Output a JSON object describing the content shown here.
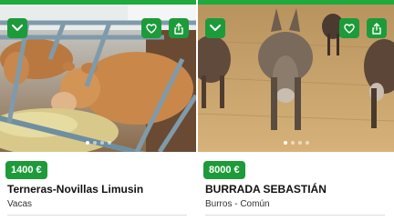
{
  "listings": [
    {
      "price": "1400 €",
      "title": "Terneras-Novillas Limusin",
      "category": "Vacas",
      "photo_icon": "cattle-photo",
      "slides": 4,
      "active_slide": 1
    },
    {
      "price": "8000 €",
      "title": "BURRADA SEBASTIÁN",
      "category": "Burros - Común",
      "photo_icon": "donkey-photo",
      "slides": 4,
      "active_slide": 1
    }
  ],
  "icons": {
    "collapse": "chevron-down-icon",
    "favorite": "heart-icon",
    "share": "share-icon"
  },
  "colors": {
    "accent": "#1d9b3a",
    "topbar": "#1eaa3c"
  }
}
